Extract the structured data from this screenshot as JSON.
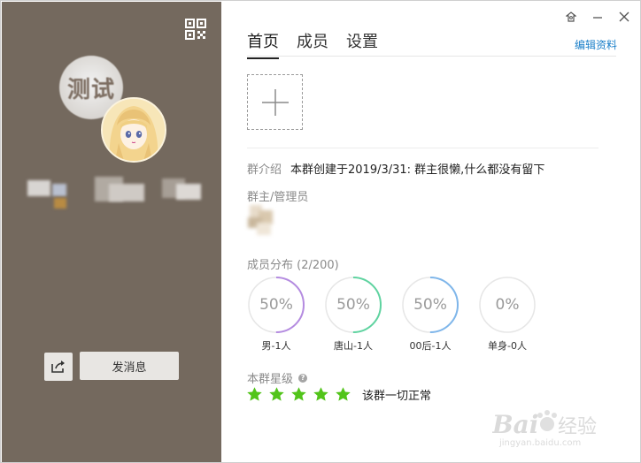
{
  "window": {
    "controls": [
      "skin-icon",
      "minimize-icon",
      "close-icon"
    ]
  },
  "left": {
    "avatar_text": "测试",
    "send_message_label": "发消息"
  },
  "tabs": [
    {
      "label": "首页",
      "active": true
    },
    {
      "label": "成员",
      "active": false
    },
    {
      "label": "设置",
      "active": false
    }
  ],
  "edit_profile_label": "编辑资料",
  "intro": {
    "label": "群介绍",
    "text": "本群创建于2019/3/31: 群主很懒,什么都没有留下"
  },
  "admins_label": "群主/管理员",
  "distribution": {
    "label": "成员分布 (2/200)",
    "items": [
      {
        "pct_text": "50%",
        "caption": "男-1人",
        "value": 0.5,
        "color": "#b48be0"
      },
      {
        "pct_text": "50%",
        "caption": "唐山-1人",
        "value": 0.5,
        "color": "#5fd3a0"
      },
      {
        "pct_text": "50%",
        "caption": "00后-1人",
        "value": 0.5,
        "color": "#7fb6ea"
      },
      {
        "pct_text": "0%",
        "caption": "单身-0人",
        "value": 0,
        "color": "#e0e0e0"
      }
    ]
  },
  "level": {
    "label": "本群星级",
    "stars": 5,
    "text": "该群一切正常",
    "star_color": "#52c41a"
  },
  "watermark": {
    "title": "Baidu经验",
    "subtitle": "jingyan.baidu.com"
  }
}
